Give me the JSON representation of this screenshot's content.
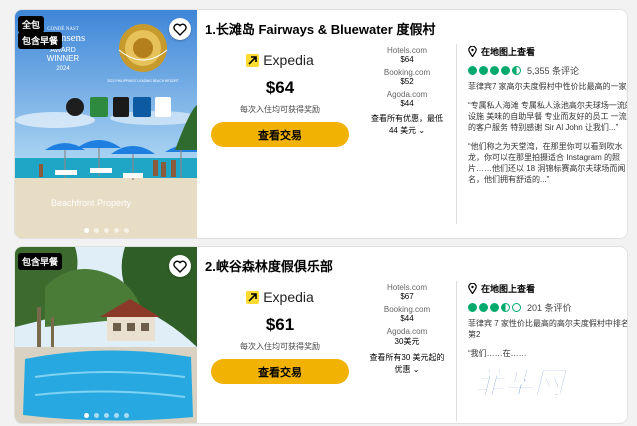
{
  "colors": {
    "accent_yellow": "#f2b203",
    "rating_green": "#00aa6c",
    "expedia_yellow": "#fddb32"
  },
  "hotels": [
    {
      "title": "1.长滩岛 Fairways & Bluewater 度假村",
      "badges": [
        "全包",
        "包含早餐"
      ],
      "photo_caption": "Beachfront Property",
      "awards": {
        "condenast_top": "CONDÉ NAST",
        "condenast_mid": "Johansens",
        "condenast_award": "AWARD",
        "condenast_winner": "WINNER",
        "condenast_year": "2024",
        "leading_text": "2022 PHILIPPINES' LEADING BEACH RESORT"
      },
      "provider_icon": "expedia-arrow-icon",
      "provider": "Expedia",
      "price": "$64",
      "reward_note": "每次入住均可获得奖励",
      "deal_button": "查看交易",
      "other_sites": [
        {
          "name": "Hotels.com",
          "price": "$64"
        },
        {
          "name": "Booking.com",
          "price": "$52"
        },
        {
          "name": "Agoda.com",
          "price": "$44"
        }
      ],
      "all_offers": [
        "查看所有优惠，最低",
        "44 美元"
      ],
      "map_link": "在地图上查看",
      "rating": 4.5,
      "review_count": "5,355 条评论",
      "rank": "菲律宾7 家高尔夫度假村中性价比最高的一家",
      "quotes": [
        "“专属私人海滩 专属私人泳池高尔夫球场一流的设施 美味的自助早餐 专业而友好的员工 一流的客户服务 特别感谢 Sir Al John 让我们...”",
        "“他们称之为天堂湾，在那里你可以看到吹水龙，你可以在那里拍摄适合 Instagram 的照片……他们还以 18 洞锦标赛高尔夫球场而闻名，他们拥有舒适的...”"
      ]
    },
    {
      "title": "2.峡谷森林度假俱乐部",
      "badges": [
        "包含早餐"
      ],
      "provider_icon": "expedia-arrow-icon",
      "provider": "Expedia",
      "price": "$61",
      "reward_note": "每次入住均可获得奖励",
      "deal_button": "查看交易",
      "other_sites": [
        {
          "name": "Hotels.com",
          "price": "$67"
        },
        {
          "name": "Booking.com",
          "price": "$44"
        },
        {
          "name": "Agoda.com",
          "price": "30美元"
        }
      ],
      "all_offers": [
        "查看所有30 美元起的",
        "优惠"
      ],
      "map_link": "在地图上查看",
      "rating": 3.5,
      "review_count": "201 条评价",
      "rank": "菲律宾 7 家性价比最高的高尔夫度假村中排名第2",
      "quotes": [
        "“我们……在……"
      ]
    }
  ],
  "watermark": "菲华网"
}
